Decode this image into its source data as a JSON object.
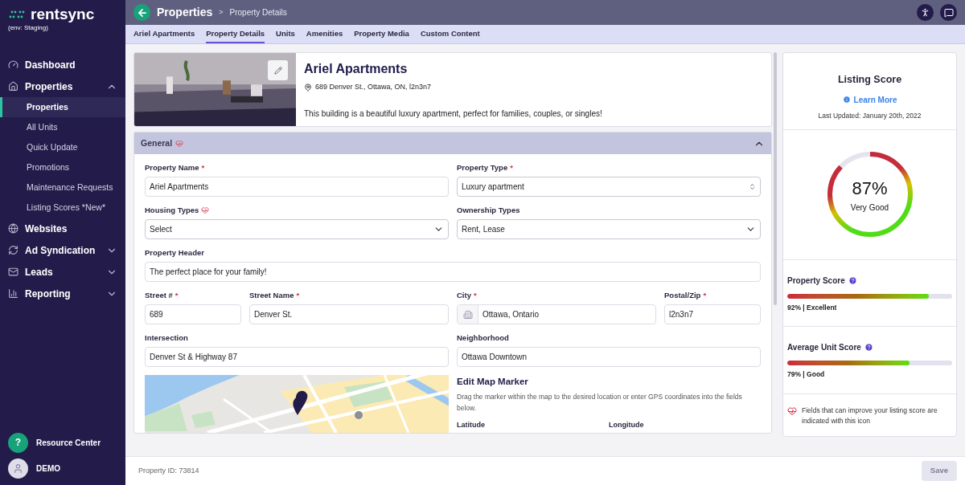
{
  "sidebar": {
    "logo": "rentsync",
    "env": "(env: Staging)",
    "items": [
      {
        "label": "Dashboard"
      },
      {
        "label": "Properties",
        "expanded": true,
        "children": [
          {
            "label": "Properties",
            "selected": true
          },
          {
            "label": "All Units",
            "selected": false
          },
          {
            "label": "Quick Update",
            "selected": false
          },
          {
            "label": "Promotions",
            "selected": false
          },
          {
            "label": "Maintenance Requests",
            "selected": false
          },
          {
            "label": "Listing Scores *New*",
            "selected": false
          }
        ]
      },
      {
        "label": "Websites"
      },
      {
        "label": "Ad Syndication",
        "expanded": false
      },
      {
        "label": "Leads",
        "expanded": false
      },
      {
        "label": "Reporting",
        "expanded": false
      }
    ],
    "resource_center": {
      "badge": "?",
      "label": "Resource Center"
    },
    "user": {
      "name": "DEMO"
    }
  },
  "header": {
    "title": "Properties",
    "separator": ">",
    "breadcrumb": "Property Details"
  },
  "tabs": [
    {
      "label": "Ariel Apartments",
      "selected": false
    },
    {
      "label": "Property Details",
      "selected": true
    },
    {
      "label": "Units",
      "selected": false
    },
    {
      "label": "Amenities",
      "selected": false
    },
    {
      "label": "Property Media",
      "selected": false
    },
    {
      "label": "Custom Content",
      "selected": false
    }
  ],
  "property": {
    "name": "Ariel Apartments",
    "address": "689 Denver St., Ottawa, ON, l2n3n7",
    "description": "This building is a beautiful luxury apartment, perfect for families, couples, or singles!"
  },
  "section": {
    "title": "General",
    "expanded": true,
    "rows": [
      [
        {
          "label": "Property Name",
          "required_mark": "*",
          "improves_score": false,
          "kind": "text",
          "value": "Ariel Apartments"
        },
        {
          "label": "Property Type",
          "required_mark": "*",
          "improves_score": false,
          "kind": "spinner",
          "value": "Luxury apartment"
        }
      ],
      [
        {
          "label": "Housing Types",
          "improves_score": true,
          "kind": "select",
          "value": "Select"
        },
        {
          "label": "Ownership Types",
          "improves_score": false,
          "kind": "select",
          "value": "Rent, Lease"
        }
      ],
      [
        {
          "label": "Property Header",
          "improves_score": false,
          "kind": "text",
          "value": "The perfect place for your family!"
        }
      ],
      [
        {
          "label": "Street #",
          "required_mark": "*",
          "improves_score": false,
          "kind": "text",
          "value": "689"
        },
        {
          "label": "Street Name",
          "required_mark": "*",
          "improves_score": false,
          "kind": "text",
          "value": "Denver St."
        },
        {
          "label": "City",
          "required_mark": "*",
          "improves_score": false,
          "kind": "city",
          "value": "Ottawa, Ontario"
        },
        {
          "label": "Postal/Zip",
          "required_mark": "*",
          "improves_score": false,
          "kind": "text",
          "value": "l2n3n7"
        }
      ],
      [
        {
          "label": "Intersection",
          "improves_score": false,
          "kind": "text",
          "value": "Denver St & Highway 87"
        },
        {
          "label": "Neighborhood",
          "improves_score": false,
          "kind": "text",
          "value": "Ottawa Downtown"
        }
      ]
    ],
    "map_marker": {
      "title": "Edit Map Marker",
      "hint": "Drag the marker within the map to the desired location or enter GPS coordinates into the fields below.",
      "latitude_label": "Latitude",
      "longitude_label": "Longitude"
    }
  },
  "listing_score": {
    "title": "Listing Score",
    "learn_more": "Learn More",
    "updated": "Last Updated: January 20th, 2022",
    "score": "87%",
    "rating": "Very Good",
    "level": 0.87,
    "metrics": [
      {
        "label": "Property Score",
        "level": 0.86,
        "reading": "92% | Excellent"
      },
      {
        "label": "Average Unit Score",
        "level": 0.74,
        "reading": "79% | Good"
      }
    ],
    "note": "Fields that can improve your listing score are indicated with this icon"
  },
  "footer": {
    "property_id": "Property ID: 73814",
    "save": {
      "label": "Save",
      "disabled": true
    }
  }
}
